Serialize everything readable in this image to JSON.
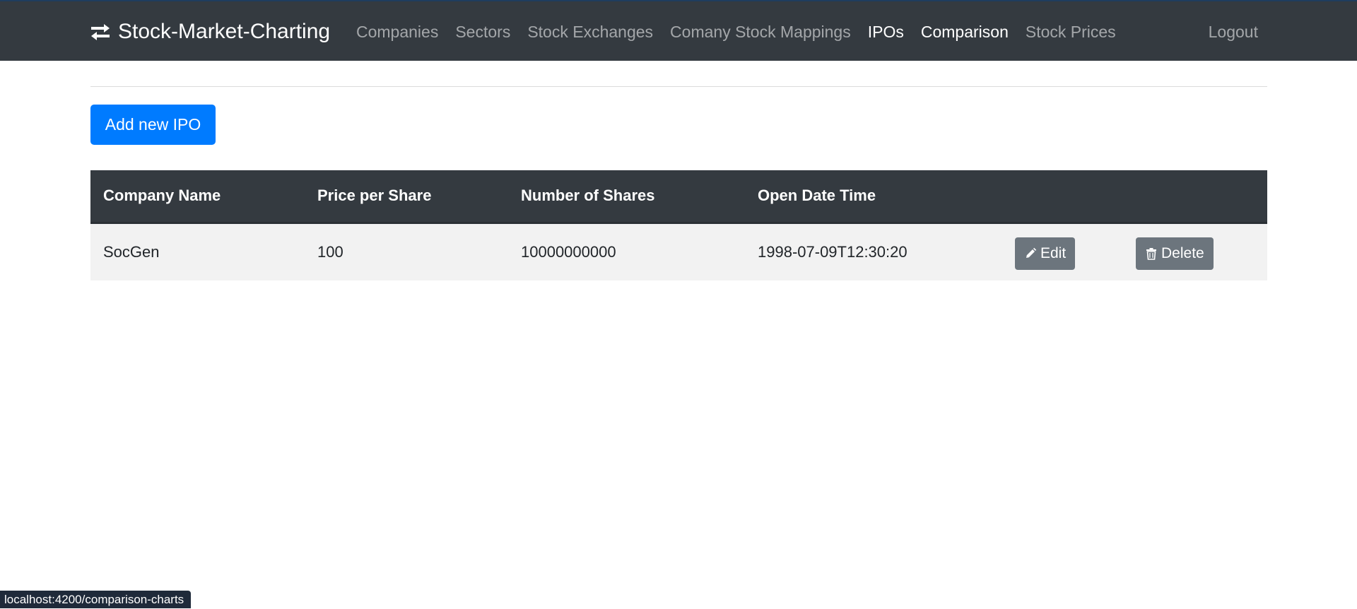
{
  "navbar": {
    "brand": "Stock-Market-Charting",
    "brand_icon": "exchange-arrows-icon",
    "links": [
      {
        "label": "Companies",
        "active": false
      },
      {
        "label": "Sectors",
        "active": false
      },
      {
        "label": "Stock Exchanges",
        "active": false
      },
      {
        "label": "Comany Stock Mappings",
        "active": false
      },
      {
        "label": "IPOs",
        "active": true
      },
      {
        "label": "Comparison",
        "active": true
      },
      {
        "label": "Stock Prices",
        "active": false
      }
    ],
    "logout": "Logout"
  },
  "main": {
    "add_button": "Add new IPO",
    "table": {
      "headers": [
        "Company Name",
        "Price per Share",
        "Number of Shares",
        "Open Date Time"
      ],
      "rows": [
        {
          "company": "SocGen",
          "price": "100",
          "shares": "10000000000",
          "open_datetime": "1998-07-09T12:30:20",
          "edit_label": "Edit",
          "delete_label": "Delete"
        }
      ]
    }
  },
  "statusbar": {
    "url": "localhost:4200/comparison-charts"
  },
  "colors": {
    "navbar_bg": "#343a40",
    "primary": "#007bff",
    "secondary": "#6c757d"
  }
}
